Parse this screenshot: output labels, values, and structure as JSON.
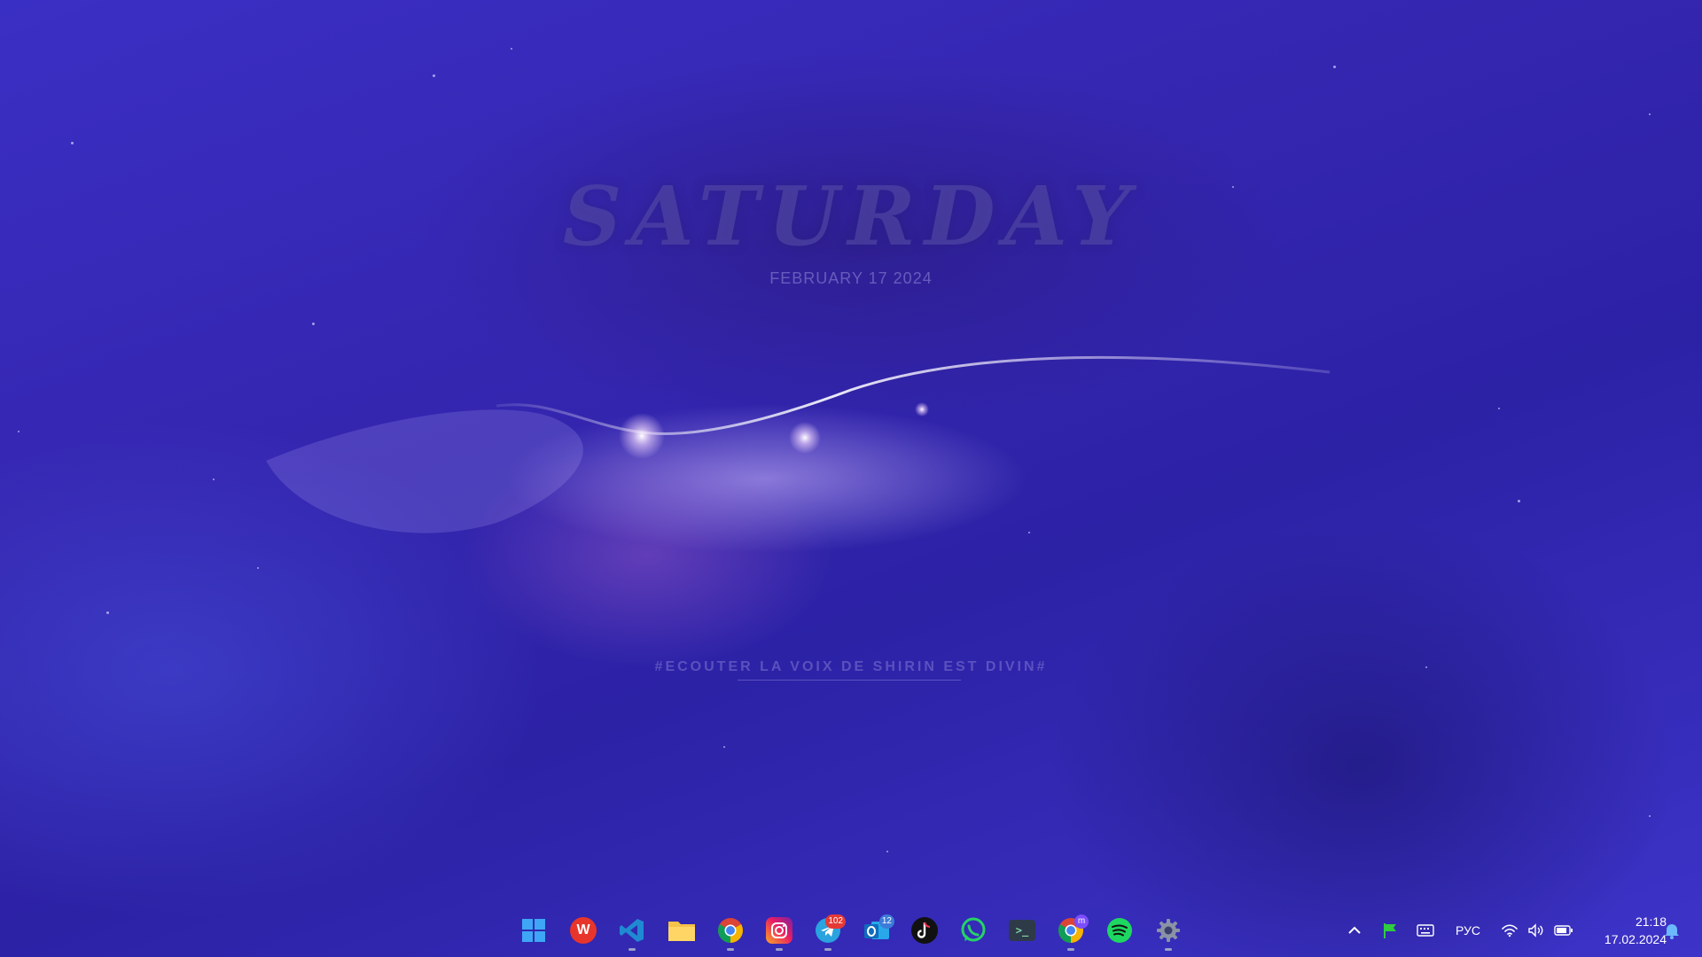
{
  "widget": {
    "day": "SATURDAY",
    "date": "FEBRUARY  17  2024",
    "quote": "#ECOUTER LA VOIX DE SHIRIN EST DIVIN#"
  },
  "taskbar": {
    "apps": [
      {
        "name": "Start",
        "icon": "windows-start-icon"
      },
      {
        "name": "WPS Office",
        "icon": "wps-office-icon",
        "label": "W",
        "color": "#e8352b"
      },
      {
        "name": "Visual Studio Code",
        "icon": "vscode-icon",
        "color": "#1f8ad2"
      },
      {
        "name": "File Explorer",
        "icon": "folder-icon",
        "color": "#f5c24a"
      },
      {
        "name": "Google Chrome",
        "icon": "chrome-icon"
      },
      {
        "name": "Instagram",
        "icon": "instagram-icon"
      },
      {
        "name": "Telegram",
        "icon": "telegram-icon",
        "badge": "102"
      },
      {
        "name": "Outlook",
        "icon": "outlook-icon",
        "badge": "12"
      },
      {
        "name": "TikTok",
        "icon": "tiktok-icon"
      },
      {
        "name": "WhatsApp",
        "icon": "whatsapp-icon"
      },
      {
        "name": "Terminal",
        "icon": "terminal-icon"
      },
      {
        "name": "Google Chrome Profile",
        "icon": "chrome-profile-icon",
        "badge": "m"
      },
      {
        "name": "Spotify",
        "icon": "spotify-icon"
      },
      {
        "name": "Settings",
        "icon": "gear-icon"
      }
    ],
    "tray": {
      "language": "РУС",
      "time": "21:18",
      "date": "17.02.2024"
    }
  }
}
